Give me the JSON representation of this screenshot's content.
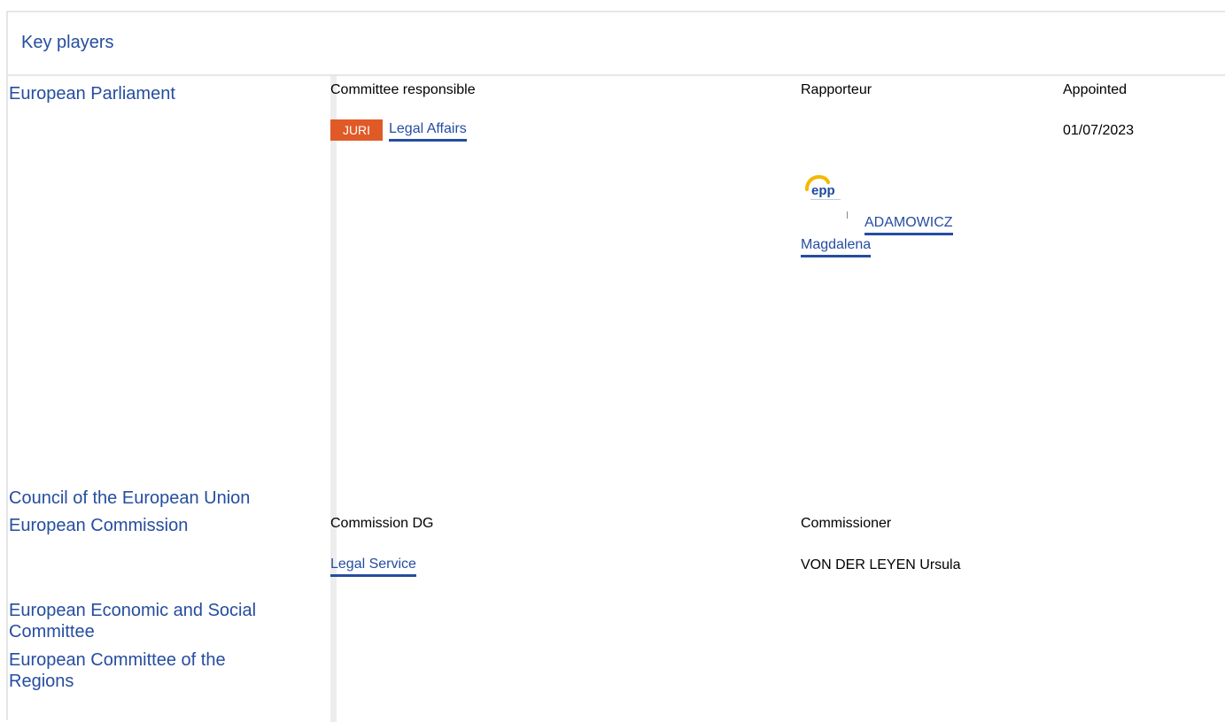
{
  "section_title": "Key players",
  "institutions": {
    "parliament": "European Parliament",
    "council": "Council of the European Union",
    "commission": "European Commission",
    "eesc": "European Economic and Social Committee",
    "cor": "European Committee of the Regions"
  },
  "parliament": {
    "col_committee": "Committee responsible",
    "col_rapporteur": "Rapporteur",
    "col_appointed": "Appointed",
    "committee_code": "JURI",
    "committee_name": "Legal Affairs",
    "appointed_date": "01/07/2023",
    "group_logo": "epp-group-logo",
    "rapporteur_line1": "ADAMOWICZ",
    "rapporteur_line2": "Magdalena"
  },
  "commission": {
    "col_dg": "Commission DG",
    "col_commissioner": "Commissioner",
    "dg_name": "Legal Service",
    "commissioner_name": "VON DER LEYEN Ursula"
  },
  "colors": {
    "link": "#254d9f",
    "badge": "#e05a28",
    "border": "#e6e6e6"
  }
}
